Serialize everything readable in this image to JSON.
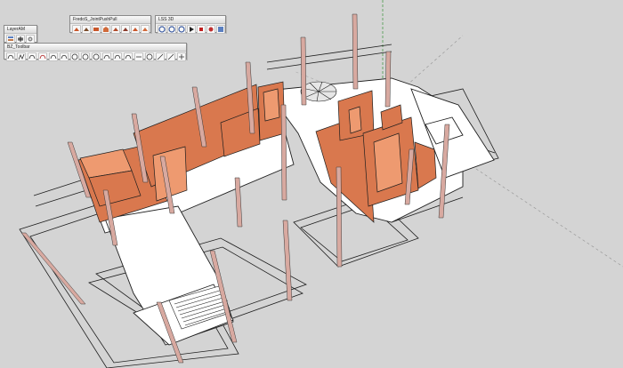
{
  "toolbars": {
    "layers": {
      "title": "LayerAM"
    },
    "fredo": {
      "title": "FredoS_JointPushPull"
    },
    "lss": {
      "title": "LSS 3D"
    },
    "bz": {
      "title": "BZ_Toolbar"
    }
  },
  "icons": {
    "layers": [
      "layers-icon",
      "add-layer-icon",
      "layer-settings-icon"
    ],
    "fredo": [
      "joint-push-pull-icon",
      "vector-push-pull-icon",
      "normal-push-pull-icon",
      "extrude-icon",
      "thicken-icon",
      "undo-push-pull-icon",
      "redo-push-pull-icon",
      "finish-icon",
      "settings-icon"
    ],
    "lss": [
      "orbit-icon",
      "rotate-icon",
      "animate-icon",
      "play-icon",
      "stop-icon",
      "record-icon",
      "export-icon"
    ],
    "bz": [
      "bezier-icon",
      "polyline-icon",
      "cubic-bezier-icon",
      "spline-icon",
      "curve-icon",
      "arc-icon",
      "circle-icon",
      "polygon-icon",
      "catmull-icon",
      "fspline-icon",
      "bspline-icon",
      "fit-curve-icon",
      "divider-icon",
      "edit-icon",
      "rotate-icon",
      "settings-icon",
      "help-icon"
    ]
  },
  "colors": {
    "background": "#d4d4d4",
    "wall": "#d9784e",
    "wall_light": "#ee9a70",
    "column": "#d8a9a0",
    "floor": "#ffffff",
    "line": "#222222",
    "toolbar_bg": "#eeeeee"
  }
}
